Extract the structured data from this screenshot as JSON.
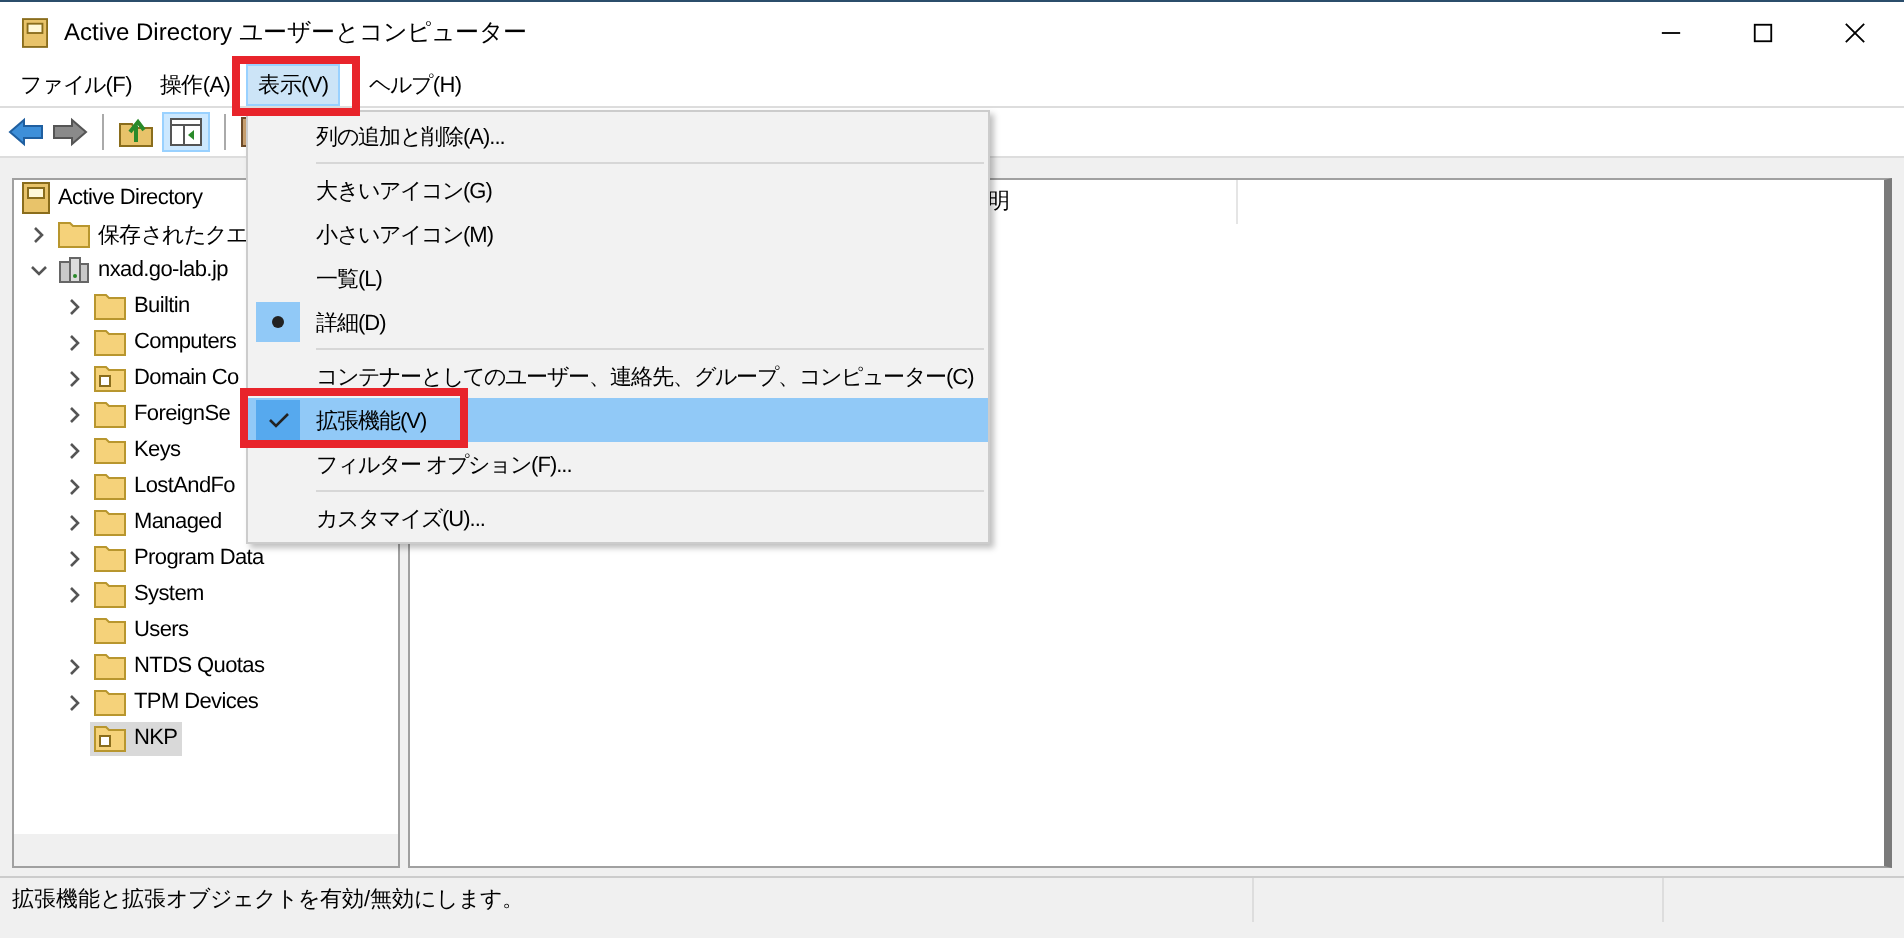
{
  "window": {
    "title": "Active Directory ユーザーとコンピューター"
  },
  "menu_bar": [
    {
      "label": "ファイル(F)",
      "selected": false
    },
    {
      "label": "操作(A)",
      "selected": false
    },
    {
      "label": "表示(V)",
      "selected": true
    },
    {
      "label": "ヘルプ(H)",
      "selected": false
    }
  ],
  "tree": [
    {
      "label": "Active Directory",
      "kind": "root",
      "selected": false,
      "children": [
        {
          "label": "保存されたクエ",
          "kind": "folder",
          "expanded": false,
          "selected": false
        },
        {
          "label": "nxad.go-lab.jp",
          "kind": "domain",
          "expanded": true,
          "selected": false,
          "children": [
            {
              "label": "Builtin",
              "kind": "folder",
              "expanded": false,
              "selected": false
            },
            {
              "label": "Computers",
              "kind": "folder",
              "expanded": false,
              "selected": false
            },
            {
              "label": "Domain Co",
              "kind": "ou",
              "expanded": false,
              "selected": false
            },
            {
              "label": "ForeignSe",
              "kind": "folder",
              "expanded": false,
              "selected": false
            },
            {
              "label": "Keys",
              "kind": "folder",
              "expanded": false,
              "selected": false
            },
            {
              "label": "LostAndFo",
              "kind": "folder",
              "expanded": false,
              "selected": false
            },
            {
              "label": "Managed",
              "kind": "folder",
              "expanded": false,
              "selected": false
            },
            {
              "label": "Program Data",
              "kind": "folder",
              "expanded": false,
              "selected": false
            },
            {
              "label": "System",
              "kind": "folder",
              "expanded": false,
              "selected": false
            },
            {
              "label": "Users",
              "kind": "folder",
              "selected": false
            },
            {
              "label": "NTDS Quotas",
              "kind": "folder",
              "expanded": false,
              "selected": false
            },
            {
              "label": "TPM Devices",
              "kind": "folder",
              "expanded": false,
              "selected": false
            },
            {
              "label": "NKP",
              "kind": "ou",
              "selected": true
            }
          ]
        }
      ]
    }
  ],
  "list": {
    "columns": [
      "明"
    ]
  },
  "view_menu": [
    {
      "kind": "item",
      "label": "列の追加と削除(A)...",
      "selected": false
    },
    {
      "kind": "separator"
    },
    {
      "kind": "item",
      "label": "大きいアイコン(G)",
      "selected": false
    },
    {
      "kind": "item",
      "label": "小さいアイコン(M)",
      "selected": false
    },
    {
      "kind": "item",
      "label": "一覧(L)",
      "selected": false
    },
    {
      "kind": "radio",
      "label": "詳細(D)",
      "checked": true,
      "selected": false
    },
    {
      "kind": "separator"
    },
    {
      "kind": "item",
      "label": "コンテナーとしてのユーザー、連絡先、グループ、コンピューター(C)",
      "selected": false
    },
    {
      "kind": "check",
      "label": "拡張機能(V)",
      "checked": true,
      "selected": true
    },
    {
      "kind": "item",
      "label": "フィルター オプション(F)...",
      "selected": false
    },
    {
      "kind": "separator"
    },
    {
      "kind": "item",
      "label": "カスタマイズ(U)...",
      "selected": false
    }
  ],
  "status_bar": {
    "text": "拡張機能と拡張オブジェクトを有効/無効にします。"
  }
}
